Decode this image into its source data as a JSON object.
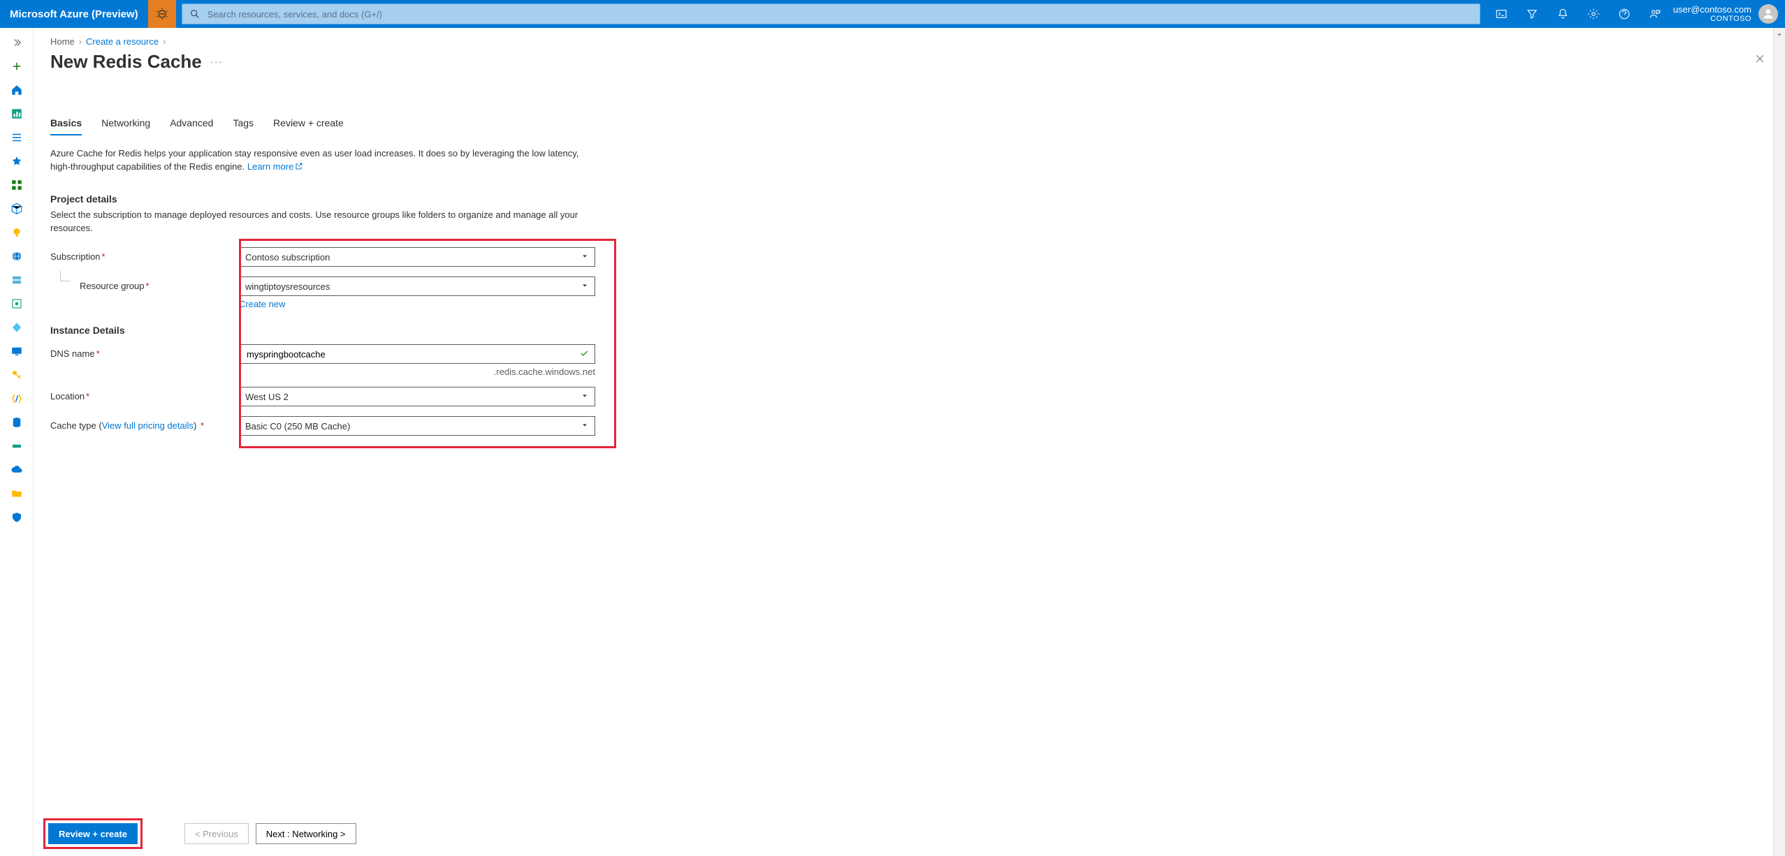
{
  "topbar": {
    "brand": "Microsoft Azure (Preview)",
    "search_placeholder": "Search resources, services, and docs (G+/)",
    "account_email": "user@contoso.com",
    "account_tenant": "CONTOSO"
  },
  "breadcrumbs": {
    "home": "Home",
    "create": "Create a resource"
  },
  "page": {
    "title": "New Redis Cache",
    "more": "···"
  },
  "tabs": {
    "basics": "Basics",
    "networking": "Networking",
    "advanced": "Advanced",
    "tags": "Tags",
    "review": "Review + create"
  },
  "intro": {
    "text": "Azure Cache for Redis helps your application stay responsive even as user load increases. It does so by leveraging the low latency, high-throughput capabilities of the Redis engine.  ",
    "learn_more": "Learn more"
  },
  "sections": {
    "project": {
      "header": "Project details",
      "desc": "Select the subscription to manage deployed resources and costs. Use resource groups like folders to organize and manage all your resources."
    },
    "instance": {
      "header": "Instance Details"
    }
  },
  "form": {
    "subscription": {
      "label": "Subscription",
      "value": "Contoso subscription"
    },
    "resource_group": {
      "label": "Resource group",
      "value": "wingtiptoysresources",
      "create_new": "Create new"
    },
    "dns_name": {
      "label": "DNS name",
      "value": "myspringbootcache",
      "suffix": ".redis.cache.windows.net"
    },
    "location": {
      "label": "Location",
      "value": "West US 2"
    },
    "cache_type": {
      "label": "Cache type",
      "pricing_link": "View full pricing details",
      "value": "Basic C0 (250 MB Cache)"
    }
  },
  "footer": {
    "review": "Review + create",
    "prev": "< Previous",
    "next": "Next : Networking >"
  }
}
